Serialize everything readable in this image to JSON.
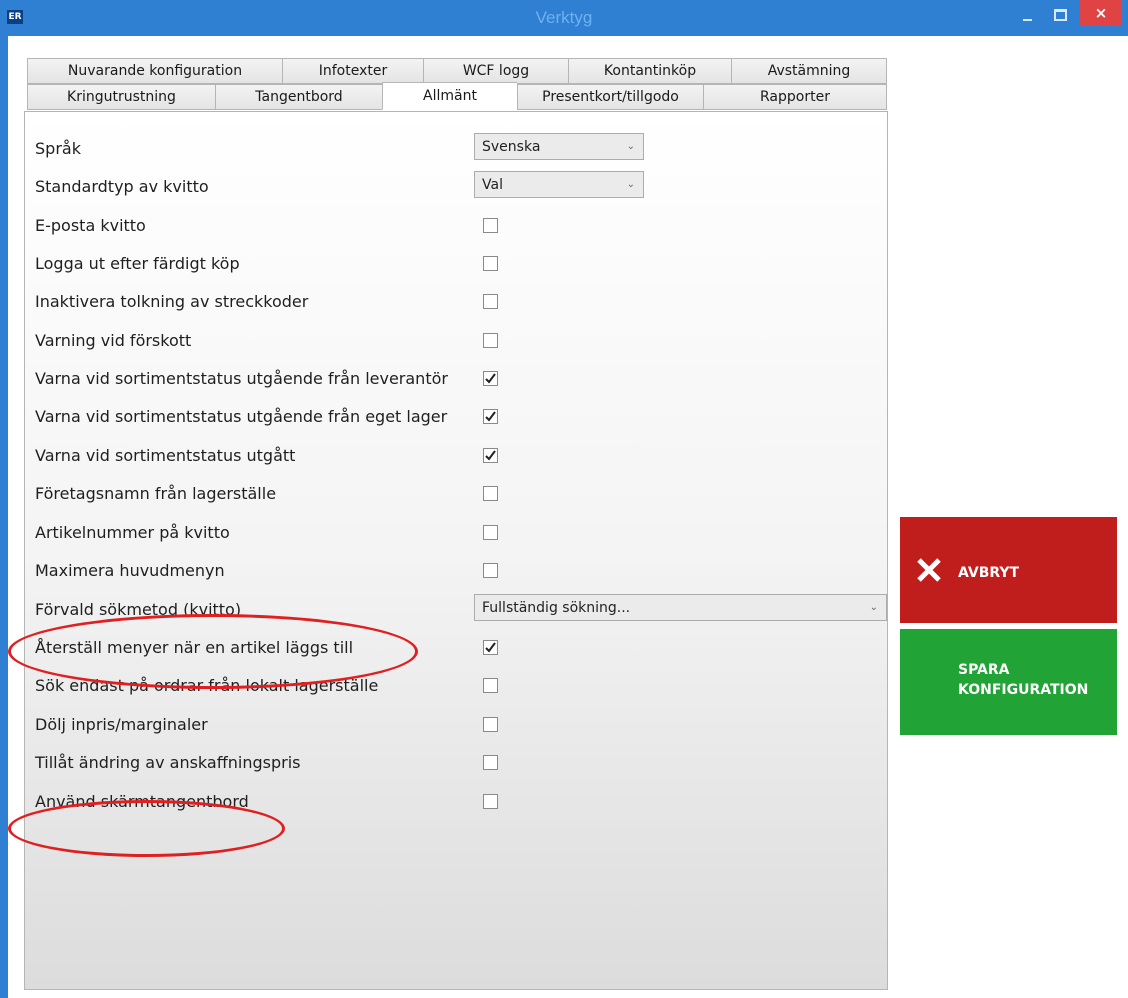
{
  "window": {
    "app_icon_text": "ER",
    "title": "Verktyg",
    "close_glyph": "×",
    "accent_color": "#2f7fd3"
  },
  "tabs": {
    "row1": [
      "Nuvarande konfiguration",
      "Infotexter",
      "WCF logg",
      "Kontantinköp",
      "Avstämning"
    ],
    "row2": [
      "Kringutrustning",
      "Tangentbord",
      "Allmänt",
      "Presentkort/tillgodo",
      "Rapporter"
    ],
    "active": "Allmänt"
  },
  "settings": [
    {
      "label": "Språk",
      "type": "select",
      "value": "Svenska"
    },
    {
      "label": "Standardtyp av kvitto",
      "type": "select",
      "value": "Val"
    },
    {
      "label": "E-posta kvitto",
      "type": "checkbox",
      "checked": false
    },
    {
      "label": "Logga ut efter färdigt köp",
      "type": "checkbox",
      "checked": false
    },
    {
      "label": "Inaktivera tolkning av streckkoder",
      "type": "checkbox",
      "checked": false
    },
    {
      "label": "Varning vid förskott",
      "type": "checkbox",
      "checked": false
    },
    {
      "label": "Varna vid sortimentstatus utgående från leverantör",
      "type": "checkbox",
      "checked": true
    },
    {
      "label": "Varna vid sortimentstatus utgående från eget lager",
      "type": "checkbox",
      "checked": true
    },
    {
      "label": "Varna vid sortimentstatus utgått",
      "type": "checkbox",
      "checked": true
    },
    {
      "label": "Företagsnamn från lagerställe",
      "type": "checkbox",
      "checked": false
    },
    {
      "label": "Artikelnummer på kvitto",
      "type": "checkbox",
      "checked": false
    },
    {
      "label": "Maximera huvudmenyn",
      "type": "checkbox",
      "checked": false
    },
    {
      "label": "Förvald sökmetod (kvitto)",
      "type": "select",
      "value": "Fullständig sökning..."
    },
    {
      "label": "Återställ menyer när en artikel läggs till",
      "type": "checkbox",
      "checked": true
    },
    {
      "label": "Sök endast på ordrar från lokalt lagerställe",
      "type": "checkbox",
      "checked": false
    },
    {
      "label": "Dölj inpris/marginaler",
      "type": "checkbox",
      "checked": false
    },
    {
      "label": "Tillåt ändring av anskaffningspris",
      "type": "checkbox",
      "checked": false
    },
    {
      "label": "Använd skärmtangentbord",
      "type": "checkbox",
      "checked": false
    }
  ],
  "actions": {
    "cancel_label": "AVBRYT",
    "cancel_color": "#c01d1d",
    "save_label": "SPARA KONFIGURATION",
    "save_color": "#21a336"
  },
  "annotations": {
    "highlight_color": "#e02020",
    "highlighted_settings": [
      "Återställ menyer när en artikel läggs till",
      "Använd skärmtangentbord"
    ]
  }
}
